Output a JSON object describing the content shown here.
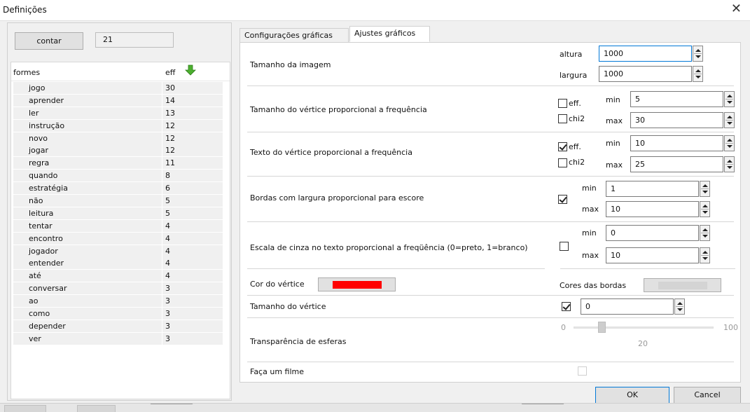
{
  "window": {
    "title": "Definições",
    "close_glyph": "✕"
  },
  "left": {
    "count_button_label": "contar",
    "count_value": "21",
    "list_headers": [
      "formes",
      "eff"
    ],
    "sort_icon": "green-down-arrow-icon",
    "rows": [
      {
        "form": "jogo",
        "eff": "30"
      },
      {
        "form": "aprender",
        "eff": "14"
      },
      {
        "form": "ler",
        "eff": "13"
      },
      {
        "form": "instrução",
        "eff": "12"
      },
      {
        "form": "novo",
        "eff": "12"
      },
      {
        "form": "jogar",
        "eff": "12"
      },
      {
        "form": "regra",
        "eff": "11"
      },
      {
        "form": "quando",
        "eff": "8"
      },
      {
        "form": "estratégia",
        "eff": "6"
      },
      {
        "form": "não",
        "eff": "5"
      },
      {
        "form": "leitura",
        "eff": "5"
      },
      {
        "form": "tentar",
        "eff": "4"
      },
      {
        "form": "encontro",
        "eff": "4"
      },
      {
        "form": "jogador",
        "eff": "4"
      },
      {
        "form": "entender",
        "eff": "4"
      },
      {
        "form": "até",
        "eff": "4"
      },
      {
        "form": "conversar",
        "eff": "3"
      },
      {
        "form": "ao",
        "eff": "3"
      },
      {
        "form": "como",
        "eff": "3"
      },
      {
        "form": "depender",
        "eff": "3"
      },
      {
        "form": "ver",
        "eff": "3"
      }
    ]
  },
  "tabs": [
    {
      "label": "Configurações gráficas",
      "active": false
    },
    {
      "label": "Ajustes gráficos",
      "active": true
    }
  ],
  "settings": {
    "image_size": {
      "label": "Tamanho da imagem",
      "altura_label": "altura",
      "altura_value": "1000",
      "largura_label": "largura",
      "largura_value": "1000"
    },
    "vertex_size": {
      "label": "Tamanho do vértice proporcional a frequência",
      "eff_label": "eff.",
      "eff_checked": false,
      "chi2_label": "chi2",
      "chi2_checked": false,
      "min_label": "min",
      "min_value": "5",
      "max_label": "max",
      "max_value": "30"
    },
    "vertex_text": {
      "label": "Texto do vértice proporcional a frequência",
      "eff_label": "eff.",
      "eff_checked": true,
      "chi2_label": "chi2",
      "chi2_checked": false,
      "min_label": "min",
      "min_value": "10",
      "max_label": "max",
      "max_value": "25"
    },
    "edge_width": {
      "label": "Bordas com largura proporcional para escore",
      "checked": true,
      "min_label": "min",
      "min_value": "1",
      "max_label": "max",
      "max_value": "10"
    },
    "gray_scale": {
      "label": "Escala de cinza no texto proporcional a freqüência (0=preto, 1=branco)",
      "checked": false,
      "min_label": "min",
      "min_value": "0",
      "max_label": "max",
      "max_value": "10"
    },
    "vertex_color": {
      "label": "Cor do vértice",
      "color": "#ff0000"
    },
    "edge_colors": {
      "label": "Cores das bordas",
      "color": "#d4d4d4"
    },
    "vertex_size_fixed": {
      "label": "Tamanho do vértice",
      "checked": true,
      "value": "0"
    },
    "sphere_transparency": {
      "label": "Transparência de esferas",
      "min": "0",
      "max": "100",
      "value": "20"
    },
    "make_movie": {
      "label": "Faça um filme",
      "checked": false
    }
  },
  "footer": {
    "ok_label": "OK",
    "cancel_label": "Cancel"
  }
}
